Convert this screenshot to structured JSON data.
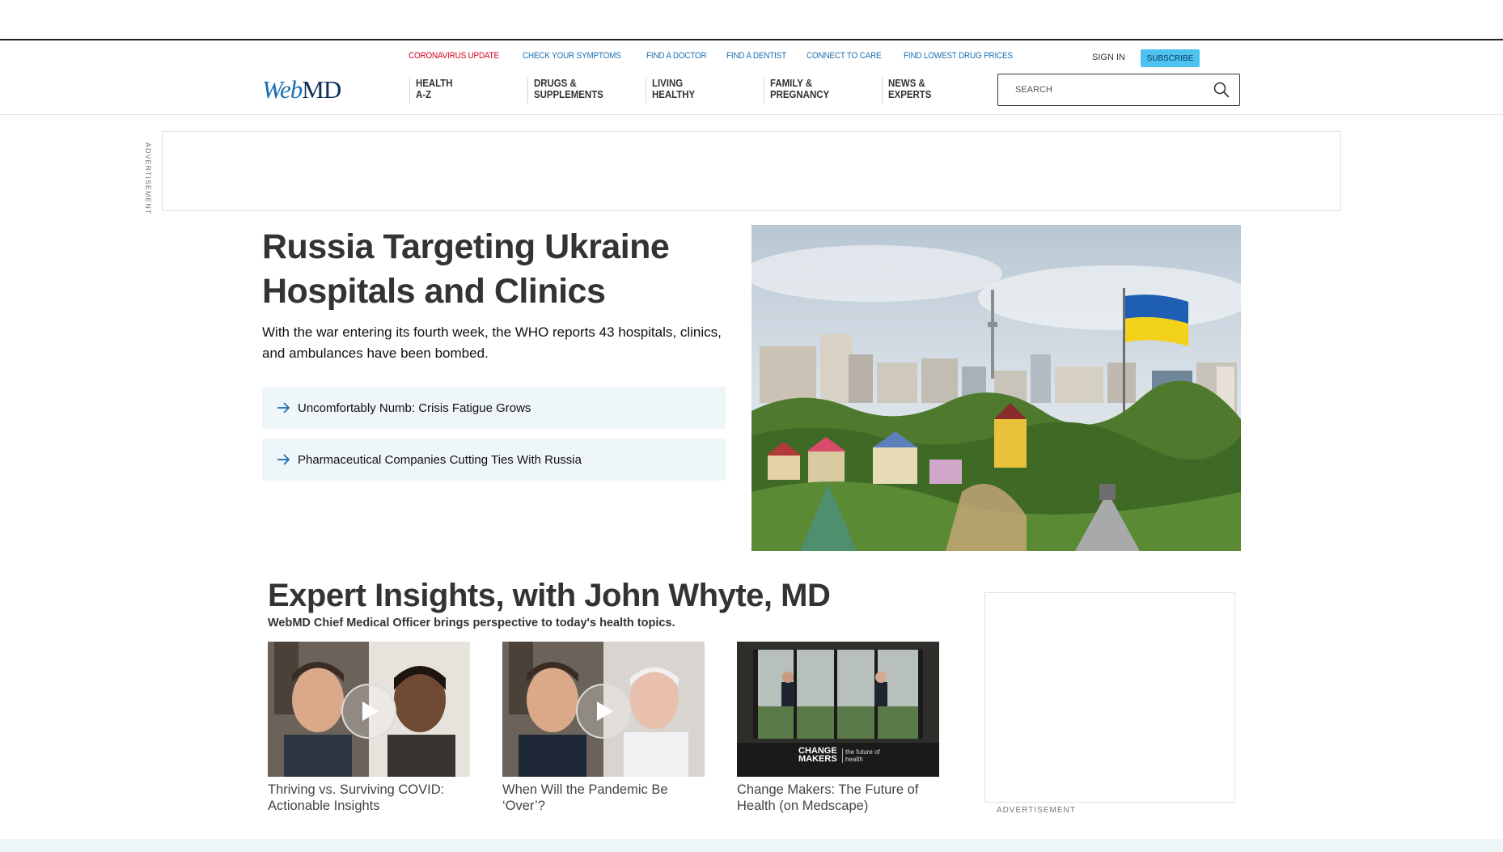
{
  "utility_nav": [
    {
      "label": "CORONAVIRUS UPDATE",
      "color": "#d0021b"
    },
    {
      "label": "CHECK YOUR SYMPTOMS"
    },
    {
      "label": "FIND A DOCTOR"
    },
    {
      "label": "FIND A DENTIST"
    },
    {
      "label": "CONNECT TO CARE"
    },
    {
      "label": "FIND LOWEST DRUG PRICES"
    }
  ],
  "account": {
    "sign_in": "SIGN IN",
    "subscribe": "SUBSCRIBE"
  },
  "logo": {
    "web": "Web",
    "md": "MD"
  },
  "main_nav": [
    {
      "line1": "HEALTH",
      "line2": "A-Z"
    },
    {
      "line1": "DRUGS &",
      "line2": "SUPPLEMENTS"
    },
    {
      "line1": "LIVING",
      "line2": "HEALTHY"
    },
    {
      "line1": "FAMILY &",
      "line2": "PREGNANCY"
    },
    {
      "line1": "NEWS &",
      "line2": "EXPERTS"
    }
  ],
  "search": {
    "placeholder": "SEARCH"
  },
  "ads": {
    "top_label": "ADVERTISEMENT",
    "side_label": "ADVERTISEMENT"
  },
  "hero": {
    "title": "Russia Targeting Ukraine Hospitals and Clinics",
    "description": "With the war entering its fourth week, the WHO reports 43 hospitals, clinics, and ambulances have been bombed.",
    "related": [
      {
        "label": "Uncomfortably Numb: Crisis Fatigue Grows"
      },
      {
        "label": "Pharmaceutical Companies Cutting Ties With Russia"
      }
    ]
  },
  "expert": {
    "title": "Expert Insights, with John Whyte, MD",
    "subtitle": "WebMD Chief Medical Officer brings perspective to today's health topics.",
    "cards": [
      {
        "caption": "Thriving vs. Surviving COVID: Actionable Insights"
      },
      {
        "caption": "When Will the Pandemic Be ‘Over’?"
      },
      {
        "caption": "Change Makers: The Future of Health (on Medscape)",
        "overlay_line1": "CHANGE",
        "overlay_line2": "MAKERS",
        "overlay_tag": "the future of health"
      }
    ]
  },
  "colors": {
    "brand_blue": "#1b6fb2",
    "alert_red": "#d0021b",
    "subscribe_bg": "#4ec2ee",
    "related_bg": "#eef6fa"
  }
}
